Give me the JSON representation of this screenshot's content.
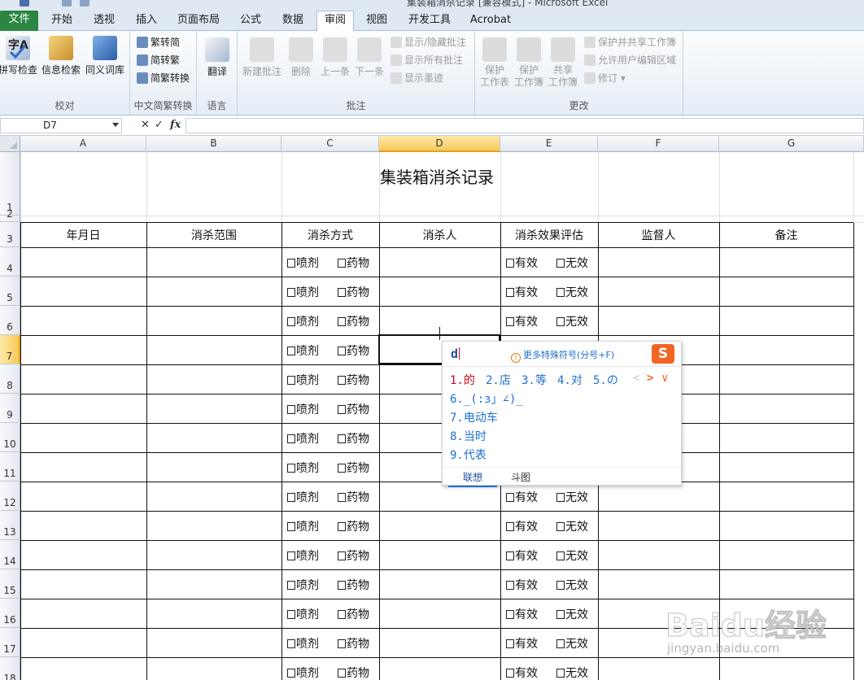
{
  "window": {
    "title": "集装箱消杀记录 [兼容模式] - Microsoft Excel"
  },
  "tabs": [
    {
      "label": "文件"
    },
    {
      "label": "开始"
    },
    {
      "label": "透视"
    },
    {
      "label": "插入"
    },
    {
      "label": "页面布局"
    },
    {
      "label": "公式"
    },
    {
      "label": "数据"
    },
    {
      "label": "审阅"
    },
    {
      "label": "视图"
    },
    {
      "label": "开发工具"
    },
    {
      "label": "Acrobat"
    }
  ],
  "ribbon": {
    "proofing": {
      "label": "校对",
      "spell": "拼写检查",
      "research": "信息检索",
      "thesaurus": "同义词库"
    },
    "chinese": {
      "label": "中文简繁转换",
      "to_simplified": "繁转简",
      "to_traditional": "简转繁",
      "convert": "简繁转换"
    },
    "language": {
      "label": "语言",
      "translate": "翻译"
    },
    "comments": {
      "label": "批注",
      "new": "新建批注",
      "delete": "删除",
      "prev": "上一条",
      "next": "下一条",
      "show_hide": "显示/隐藏批注",
      "show_all": "显示所有批注",
      "show_ink": "显示墨迹"
    },
    "changes": {
      "label": "更改",
      "protect_sheet_1": "保护",
      "protect_sheet_2": "工作表",
      "protect_book_1": "保护",
      "protect_book_2": "工作簿",
      "share_book_1": "共享",
      "share_book_2": "工作簿",
      "protect_share": "保护并共享工作簿",
      "allow_edit": "允许用户编辑区域",
      "track": "修订"
    }
  },
  "formula_bar": {
    "name_box": "D7",
    "fx": "fx",
    "value": ""
  },
  "columns": [
    "A",
    "B",
    "C",
    "D",
    "E",
    "F",
    "G"
  ],
  "rows": [
    "1",
    "2",
    "3",
    "4",
    "5",
    "6",
    "7",
    "8",
    "9",
    "10",
    "11",
    "12",
    "13",
    "14",
    "15",
    "16",
    "17",
    "18"
  ],
  "sheet": {
    "title": "集装箱消杀记录",
    "headers": [
      "年月日",
      "消杀范围",
      "消杀方式",
      "消杀人",
      "消杀效果评估",
      "监督人",
      "备注"
    ],
    "method_options": [
      "喷剂",
      "药物"
    ],
    "effect_options": [
      "有效",
      "无效"
    ]
  },
  "ime": {
    "input": "d",
    "hint": "更多特殊符号(分号+F)",
    "logo": "S",
    "candidates": [
      "1.的",
      "2.店",
      "3.等",
      "4.对",
      "5.の",
      "6._(:з」∠)_",
      "7.电动车",
      "8.当时",
      "9.代表"
    ],
    "nav_prev": "<",
    "nav_next": ">",
    "nav_more": "∨",
    "tabs": [
      "联想",
      "斗图"
    ]
  },
  "watermark": {
    "brand": "Baidu经验",
    "url": "jingyan.baidu.com"
  },
  "colors": {
    "file_tab": "#2a8640",
    "ime_first": "#d0021b",
    "ime_candidate": "#1e6fd0",
    "ime_logo": "#f26522",
    "selected_header": "#f8cb5a"
  }
}
